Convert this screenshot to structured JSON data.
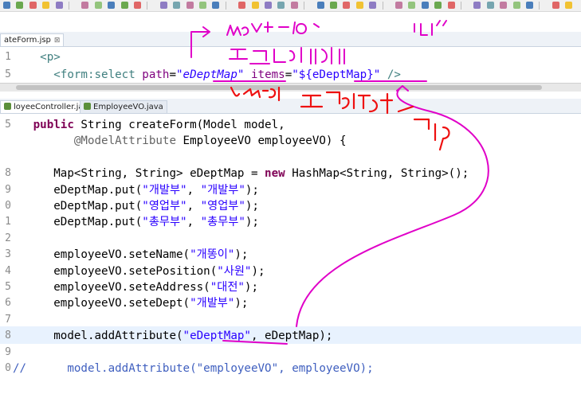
{
  "tabs_top": [
    {
      "label": "ateForm.jsp",
      "close": "⊠"
    }
  ],
  "tabs_mid": [
    {
      "label": "loyeeController.java",
      "close": "⊠"
    },
    {
      "label": "EmployeeVO.java"
    }
  ],
  "jsp_lines": [
    {
      "n": "1",
      "parts": [
        {
          "t": "    "
        },
        {
          "t": "<p>",
          "c": "tag"
        }
      ]
    },
    {
      "n": "5",
      "parts": [
        {
          "t": "      "
        },
        {
          "t": "<form:select",
          "c": "tag"
        },
        {
          "t": " "
        },
        {
          "t": "path",
          "c": "attr"
        },
        {
          "t": "="
        },
        {
          "t": "\"eDeptMap\"",
          "c": "str ital"
        },
        {
          "t": " "
        },
        {
          "t": "items",
          "c": "attr"
        },
        {
          "t": "="
        },
        {
          "t": "\"${eDeptMap}\"",
          "c": "str"
        },
        {
          "t": " "
        },
        {
          "t": "/>",
          "c": "tag"
        }
      ]
    }
  ],
  "java_lines": [
    {
      "n": "5",
      "parts": [
        {
          "t": "   "
        },
        {
          "t": "public",
          "c": "kw"
        },
        {
          "t": " String createForm(Model model,"
        }
      ]
    },
    {
      "n": "",
      "parts": [
        {
          "t": "         "
        },
        {
          "t": "@ModelAttribute",
          "c": "ann"
        },
        {
          "t": " EmployeeVO employeeVO) {"
        }
      ]
    },
    {
      "n": "",
      "parts": []
    },
    {
      "n": "8",
      "parts": [
        {
          "t": "      Map<String, String> eDeptMap = "
        },
        {
          "t": "new",
          "c": "kw"
        },
        {
          "t": " HashMap<String, String>();"
        }
      ]
    },
    {
      "n": "9",
      "parts": [
        {
          "t": "      eDeptMap.put("
        },
        {
          "t": "\"개발부\"",
          "c": "str"
        },
        {
          "t": ", "
        },
        {
          "t": "\"개발부\"",
          "c": "str"
        },
        {
          "t": ");"
        }
      ]
    },
    {
      "n": "0",
      "parts": [
        {
          "t": "      eDeptMap.put("
        },
        {
          "t": "\"영업부\"",
          "c": "str"
        },
        {
          "t": ", "
        },
        {
          "t": "\"영업부\"",
          "c": "str"
        },
        {
          "t": ");"
        }
      ]
    },
    {
      "n": "1",
      "parts": [
        {
          "t": "      eDeptMap.put("
        },
        {
          "t": "\"총무부\"",
          "c": "str"
        },
        {
          "t": ", "
        },
        {
          "t": "\"총무부\"",
          "c": "str"
        },
        {
          "t": ");"
        }
      ]
    },
    {
      "n": "2",
      "parts": []
    },
    {
      "n": "3",
      "parts": [
        {
          "t": "      employeeVO.seteName("
        },
        {
          "t": "\"개똥이\"",
          "c": "str"
        },
        {
          "t": ");"
        }
      ]
    },
    {
      "n": "4",
      "parts": [
        {
          "t": "      employeeVO.setePosition("
        },
        {
          "t": "\"사원\"",
          "c": "str"
        },
        {
          "t": ");"
        }
      ]
    },
    {
      "n": "5",
      "parts": [
        {
          "t": "      employeeVO.seteAddress("
        },
        {
          "t": "\"대전\"",
          "c": "str"
        },
        {
          "t": ");"
        }
      ]
    },
    {
      "n": "6",
      "parts": [
        {
          "t": "      employeeVO.seteDept("
        },
        {
          "t": "\"개발부\"",
          "c": "str"
        },
        {
          "t": ");"
        }
      ]
    },
    {
      "n": "7",
      "parts": []
    },
    {
      "n": "8",
      "parts": [
        {
          "t": "      model.addAttribute("
        },
        {
          "t": "\"eDeptMap\"",
          "c": "str"
        },
        {
          "t": ", eDeptMap);"
        }
      ]
    },
    {
      "n": "9",
      "parts": []
    },
    {
      "n": "0",
      "parts": [
        {
          "t": "//",
          "c": "cmt"
        },
        {
          "t": "      model.addAttribute(",
          "c": "cmt"
        },
        {
          "t": "\"employeeVO\"",
          "c": "cmt"
        },
        {
          "t": ", employeeVO);",
          "c": "cmt"
        }
      ]
    }
  ],
  "colors": {
    "ink_pink": "#e000c8",
    "ink_red": "#ee1010",
    "highlight_line": "#e8f2fe"
  }
}
